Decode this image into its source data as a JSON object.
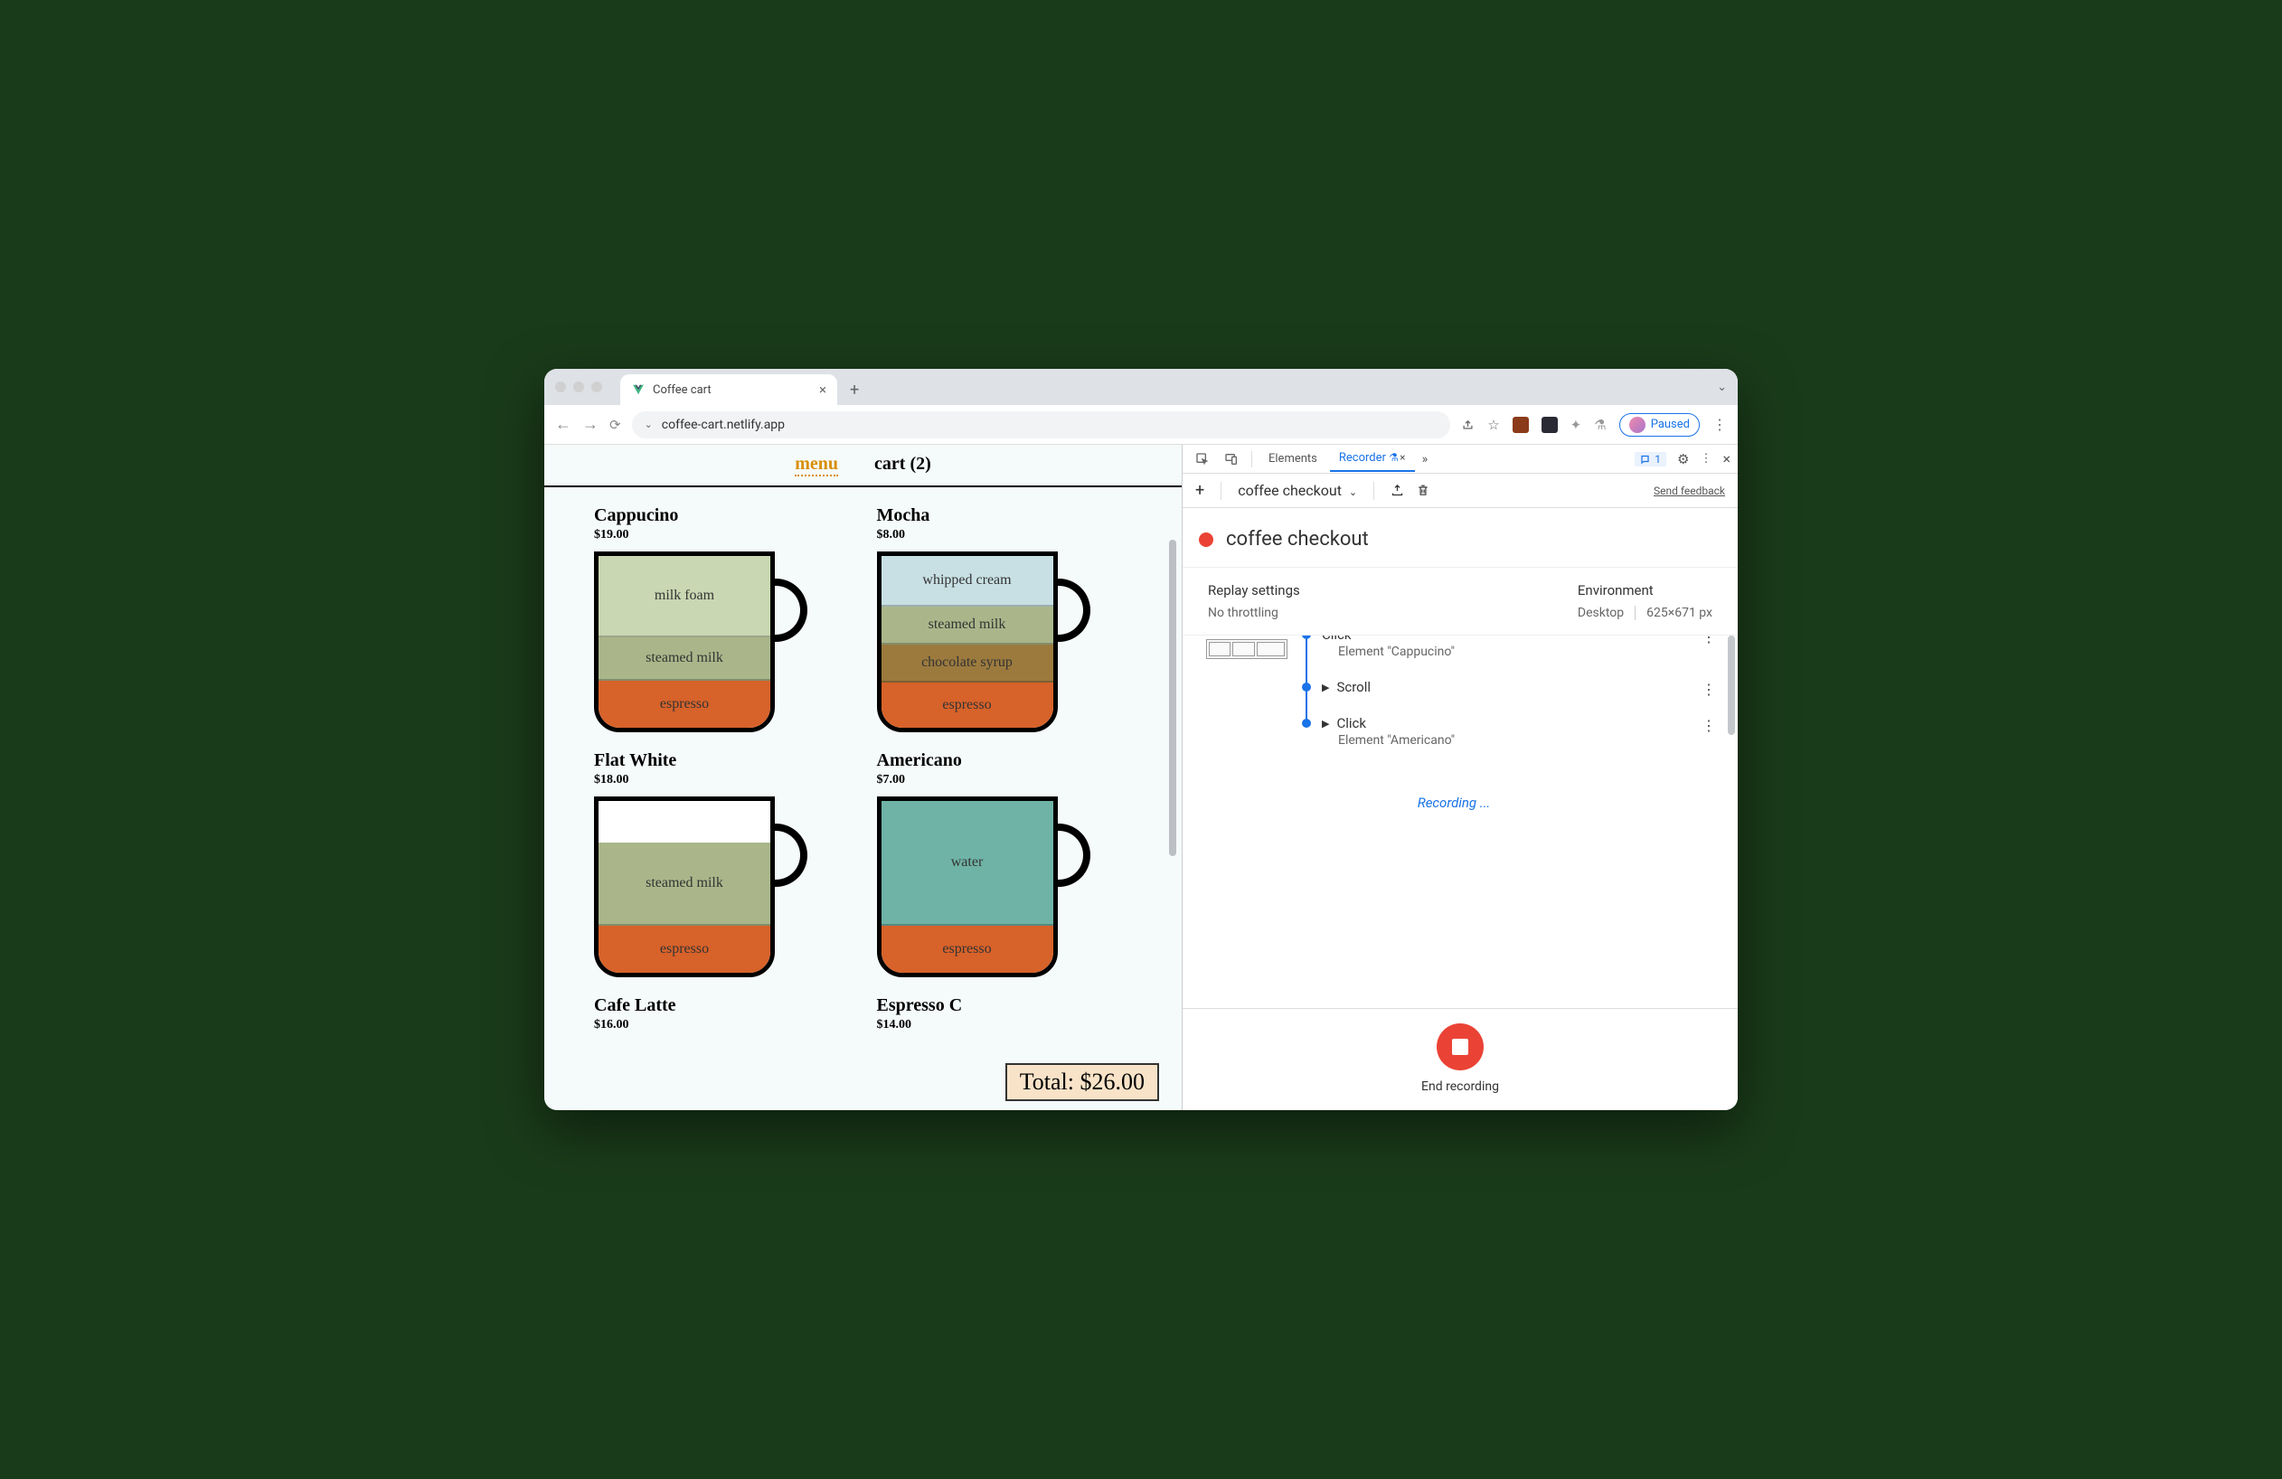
{
  "browser": {
    "tab_title": "Coffee cart",
    "url": "coffee-cart.netlify.app",
    "paused_label": "Paused"
  },
  "page": {
    "nav_menu": "menu",
    "nav_cart": "cart (2)",
    "total_label": "Total: $26.00",
    "coffees": [
      {
        "name": "Cappucino",
        "price": "$19.00",
        "layers": [
          {
            "label": "espresso",
            "color": "#d7622a",
            "h": 52
          },
          {
            "label": "steamed milk",
            "color": "#aab68a",
            "h": 48
          },
          {
            "label": "milk foam",
            "color": "#c9d7b2",
            "h": 90
          }
        ]
      },
      {
        "name": "Mocha",
        "price": "$8.00",
        "layers": [
          {
            "label": "espresso",
            "color": "#d7622a",
            "h": 50
          },
          {
            "label": "chocolate syrup",
            "color": "#9c7a3e",
            "h": 42
          },
          {
            "label": "steamed milk",
            "color": "#aab68a",
            "h": 42
          },
          {
            "label": "whipped cream",
            "color": "#c8e0e4",
            "h": 56
          }
        ]
      },
      {
        "name": "Flat White",
        "price": "$18.00",
        "layers": [
          {
            "label": "espresso",
            "color": "#d7622a",
            "h": 52
          },
          {
            "label": "steamed milk",
            "color": "#aab68a",
            "h": 92
          }
        ]
      },
      {
        "name": "Americano",
        "price": "$7.00",
        "layers": [
          {
            "label": "espresso",
            "color": "#d7622a",
            "h": 52
          },
          {
            "label": "water",
            "color": "#6fb3a6",
            "h": 138
          }
        ]
      },
      {
        "name": "Cafe Latte",
        "price": "$16.00",
        "layers": []
      },
      {
        "name": "Espresso C",
        "price": "$14.00",
        "layers": []
      }
    ]
  },
  "devtools": {
    "tabs": {
      "elements": "Elements",
      "recorder": "Recorder"
    },
    "badge_count": "1",
    "recorder": {
      "toolbar_name": "coffee checkout",
      "feedback": "Send feedback",
      "title": "coffee checkout",
      "replay_label": "Replay settings",
      "replay_value": "No throttling",
      "env_label": "Environment",
      "env_device": "Desktop",
      "env_size": "625×671 px",
      "steps": [
        {
          "action": "Click",
          "target": "Element \"Cappucino\"",
          "partial": true
        },
        {
          "action": "Scroll",
          "target": ""
        },
        {
          "action": "Click",
          "target": "Element \"Americano\""
        }
      ],
      "recording_text": "Recording ...",
      "end_label": "End recording"
    }
  }
}
